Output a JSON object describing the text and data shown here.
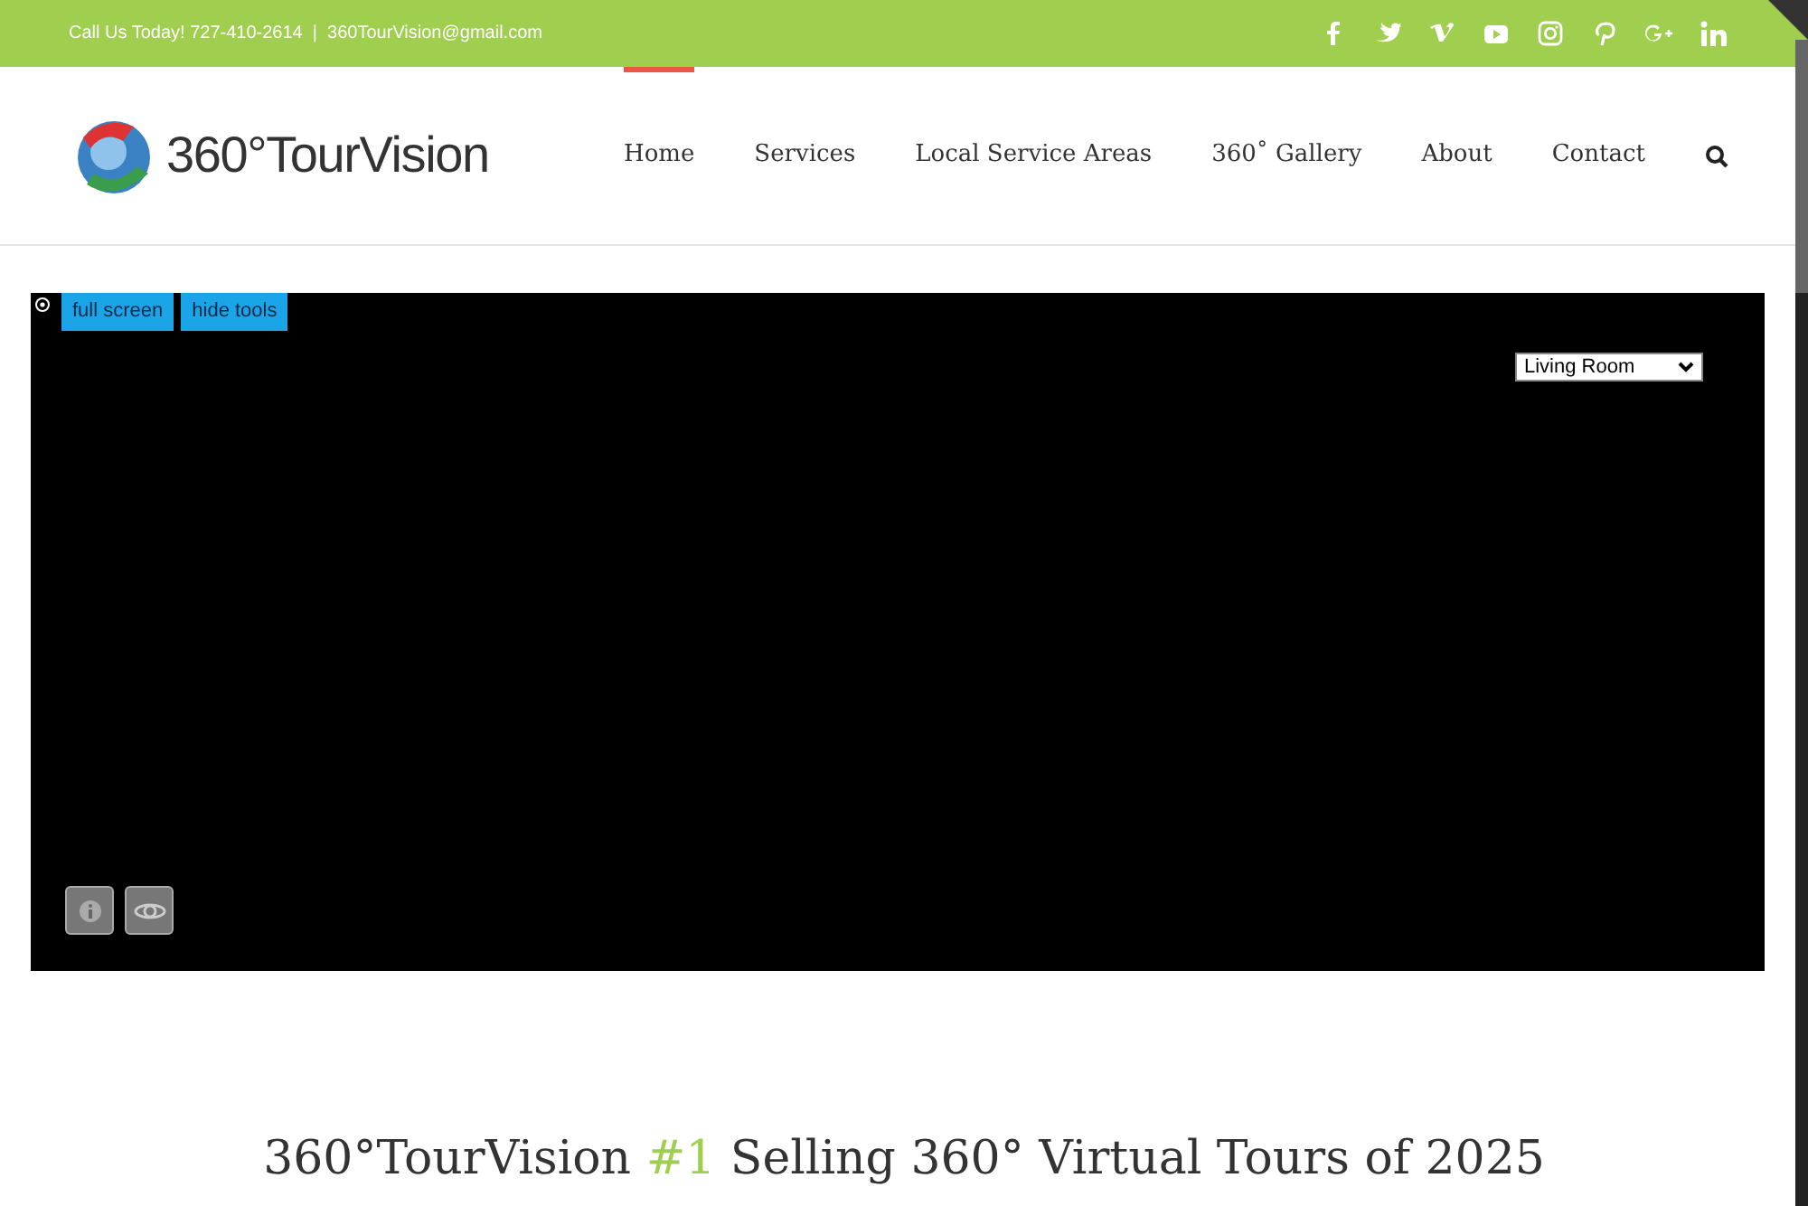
{
  "top_bar": {
    "contact": "Call Us Today! 727-410-2614  |  360TourVision@gmail.com",
    "social": [
      {
        "kind": "facebook"
      },
      {
        "kind": "twitter"
      },
      {
        "kind": "vimeo"
      },
      {
        "kind": "youtube"
      },
      {
        "kind": "instagram"
      },
      {
        "kind": "pinterest"
      },
      {
        "kind": "googleplus"
      },
      {
        "kind": "linkedin"
      }
    ]
  },
  "header": {
    "logo_text": "360°TourVision",
    "nav": [
      {
        "label": "Home",
        "selected": true
      },
      {
        "label": "Services",
        "selected": false
      },
      {
        "label": "Local Service Areas",
        "selected": false
      },
      {
        "label": "360˚ Gallery",
        "selected": false
      },
      {
        "label": "About",
        "selected": false
      },
      {
        "label": "Contact",
        "selected": false
      }
    ]
  },
  "viewer": {
    "buttons": [
      "full screen",
      "hide tools"
    ],
    "room_select": {
      "value": "Living Room"
    }
  },
  "heading": {
    "text": "360°TourVision **#1** Selling 360° Virtual Tours of 2025"
  }
}
